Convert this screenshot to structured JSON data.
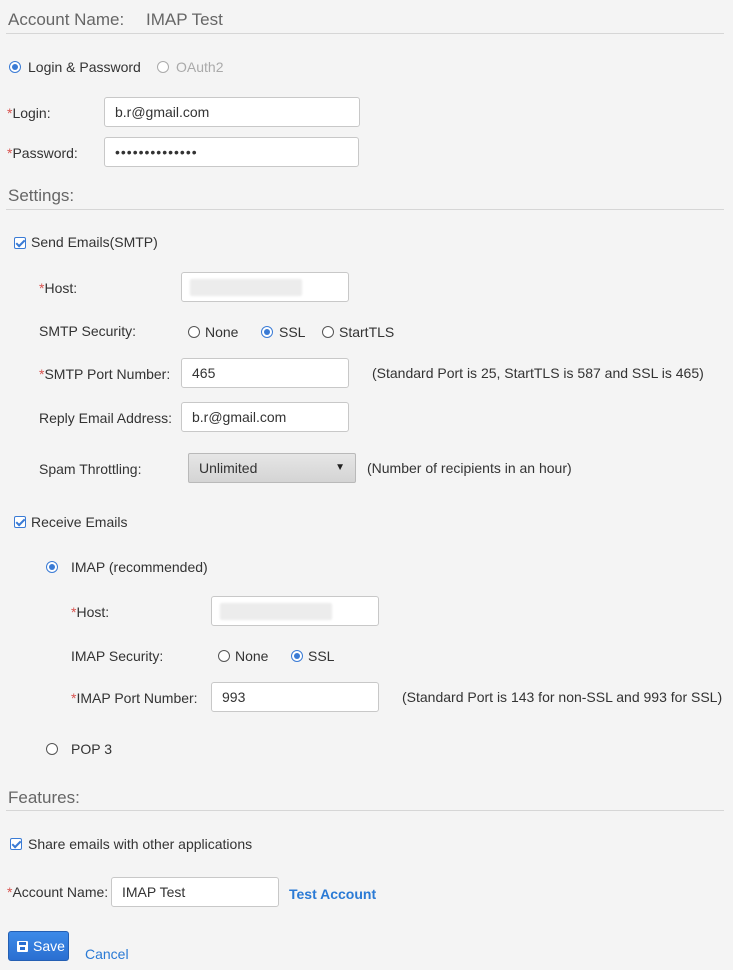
{
  "header": {
    "title": "Account Name:",
    "value": "IMAP Test"
  },
  "auth": {
    "options": [
      {
        "label": "Login & Password",
        "selected": true,
        "disabled": false
      },
      {
        "label": "OAuth2",
        "selected": false,
        "disabled": true
      }
    ]
  },
  "credentials": {
    "login_label": "Login:",
    "login_value": "b.r@gmail.com",
    "password_label": "Password:",
    "password_value": "••••••••••••••"
  },
  "settings": {
    "heading": "Settings:",
    "smtp": {
      "enable_label": "Send Emails(SMTP)",
      "enabled": true,
      "host_label": "Host:",
      "security_label": "SMTP Security:",
      "security_options": [
        {
          "label": "None",
          "selected": false
        },
        {
          "label": "SSL",
          "selected": true
        },
        {
          "label": "StartTLS",
          "selected": false
        }
      ],
      "port_label": "SMTP Port Number:",
      "port_value": "465",
      "port_note": "(Standard Port is 25, StartTLS is 587 and SSL is 465)",
      "reply_label": "Reply Email Address:",
      "reply_value": "b.r@gmail.com",
      "throttle_label": "Spam Throttling:",
      "throttle_value": "Unlimited",
      "throttle_note": "(Number of recipients in an hour)"
    },
    "receive": {
      "enable_label": "Receive Emails",
      "enabled": true,
      "imap_label": "IMAP (recommended)",
      "imap_selected": true,
      "host_label": "Host:",
      "security_label": "IMAP Security:",
      "security_options": [
        {
          "label": "None",
          "selected": false
        },
        {
          "label": "SSL",
          "selected": true
        }
      ],
      "port_label": "IMAP Port Number:",
      "port_value": "993",
      "port_note": "(Standard Port is 143 for non-SSL and 993 for SSL)",
      "pop_label": "POP 3",
      "pop_selected": false
    }
  },
  "features": {
    "heading": "Features:",
    "share_label": "Share emails with other applications",
    "share_checked": true
  },
  "account": {
    "name_label": "Account Name:",
    "name_value": "IMAP Test",
    "test_link": "Test Account"
  },
  "actions": {
    "save_label": "Save",
    "cancel_label": "Cancel"
  },
  "colors": {
    "accent": "#2a7ad5",
    "required": "#d9534f",
    "button": "#2a6fd1"
  }
}
